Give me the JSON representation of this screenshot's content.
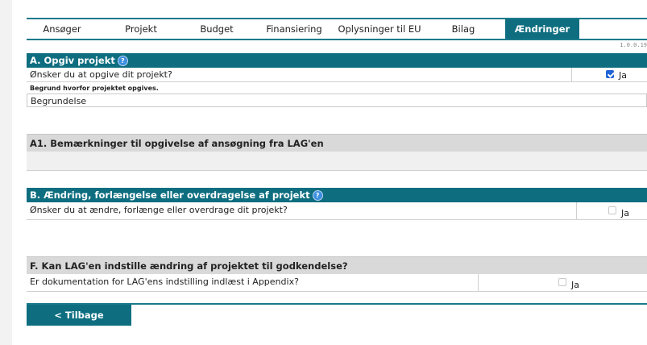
{
  "tabs": [
    {
      "label": "Ansøger",
      "active": false
    },
    {
      "label": "Projekt",
      "active": false
    },
    {
      "label": "Budget",
      "active": false
    },
    {
      "label": "Finansiering",
      "active": false
    },
    {
      "label": "Oplysninger til EU",
      "active": false
    },
    {
      "label": "Bilag",
      "active": false
    },
    {
      "label": "Ændringer",
      "active": true
    }
  ],
  "version": "1.0.0.19",
  "help_icon": "question-icon",
  "section_a": {
    "title": "A. Opgiv projekt",
    "question": "Ønsker du at opgive dit projekt?",
    "checkbox_label": "Ja",
    "checked": true,
    "reason_label": "Begrund hvorfor projektet opgives.",
    "reason_value": "Begrundelse"
  },
  "section_a1": {
    "title": "A1. Bemærkninger til opgivelse af ansøgning fra LAG'en"
  },
  "section_b": {
    "title": "B. Ændring, forlængelse eller overdragelse af projekt",
    "question": "Ønsker du at ændre, forlænge eller overdrage dit projekt?",
    "checkbox_label": "Ja",
    "checked": false
  },
  "section_f": {
    "title": "F. Kan LAG'en indstille ændring af projektet til godkendelse?",
    "question": "Er dokumentation for LAG'ens indstilling indlæst i Appendix?",
    "checkbox_label": "Ja",
    "checked": false
  },
  "back_button": "< Tilbage",
  "colors": {
    "accent": "#0e6e80",
    "section_grey": "#d9d9d9",
    "checkbox_checked": "#1f63d6"
  }
}
